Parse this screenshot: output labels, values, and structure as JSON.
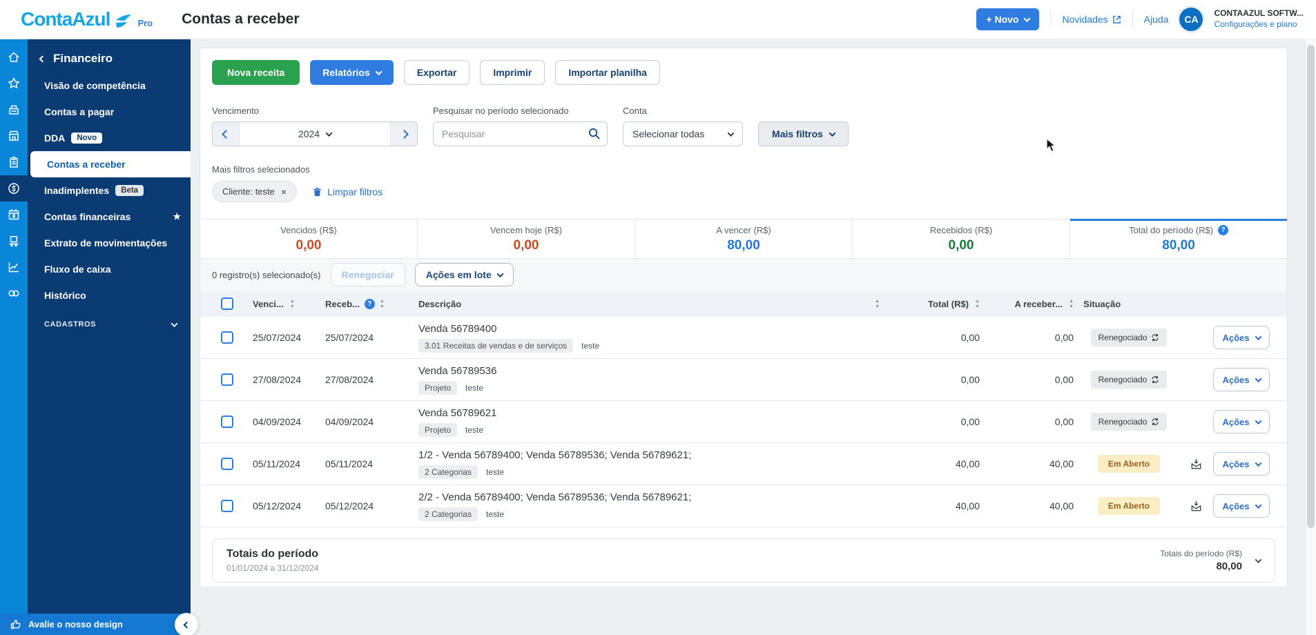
{
  "header": {
    "logo_conta_azul": "ContaAzul",
    "logo_pro": "Pro",
    "page_title": "Contas a receber",
    "novo_button": "+ Novo",
    "novidades_link": "Novidades",
    "ajuda_link": "Ajuda",
    "avatar_initials": "CA",
    "account_name": "CONTAAZUL SOFTW...",
    "account_link": "Configurações e plano"
  },
  "sidebar": {
    "rail_icons": [
      "home",
      "star",
      "cash-register",
      "store",
      "clipboard",
      "dollar-circle",
      "calendar-money",
      "delivery",
      "line-chart",
      "link"
    ],
    "rail_active_index": 5,
    "back_label": "Financeiro",
    "items": [
      {
        "label": "Visão de competência"
      },
      {
        "label": "Contas a pagar"
      },
      {
        "label": "DDA",
        "badge": "Novo",
        "badge_style": "white"
      },
      {
        "label": "Contas a receber",
        "active": true
      },
      {
        "label": "Inadimplentes",
        "badge": "Beta",
        "badge_style": "gray"
      },
      {
        "label": "Contas financeiras",
        "star": true
      },
      {
        "label": "Extrato de movimentações"
      },
      {
        "label": "Fluxo de caixa"
      },
      {
        "label": "Histórico"
      }
    ],
    "cadastros_label": "CADASTROS",
    "rate_design_label": "Avalie o nosso design"
  },
  "actions": {
    "nova_receita": "Nova receita",
    "relatorios": "Relatórios",
    "exportar": "Exportar",
    "imprimir": "Imprimir",
    "importar_planilha": "Importar planilha"
  },
  "filters": {
    "vencimento_label": "Vencimento",
    "year_value": "2024",
    "search_label": "Pesquisar no período selecionado",
    "search_placeholder": "Pesquisar",
    "conta_label": "Conta",
    "conta_value": "Selecionar todas",
    "mais_filtros_button": "Mais filtros",
    "selected_label": "Mais filtros selecionados",
    "chip_label": "Cliente: teste",
    "limpar_filtros": "Limpar filtros"
  },
  "summary_cards": [
    {
      "label": "Vencidos (R$)",
      "value": "0,00",
      "color": "#cb4a23"
    },
    {
      "label": "Vencem hoje (R$)",
      "value": "0,00",
      "color": "#cb4a23"
    },
    {
      "label": "A vencer (R$)",
      "value": "80,00",
      "color": "#2277d4"
    },
    {
      "label": "Recebidos (R$)",
      "value": "0,00",
      "color": "#1e7a3c"
    },
    {
      "label": "Total do período (R$)",
      "value": "80,00",
      "color": "#2277d4",
      "help": true,
      "active": true
    }
  ],
  "list_toolbar": {
    "selection_text": "0 registro(s) selecionado(s)",
    "renegociar_button": "Renegociar",
    "acoes_em_lote_button": "Ações em lote"
  },
  "table": {
    "headers": {
      "vencimento": "Venci...",
      "recebimento": "Receb...",
      "descricao": "Descrição",
      "total": "Total (R$)",
      "a_receber": "A receber...",
      "situacao": "Situação"
    },
    "acoes_label": "Ações",
    "rows": [
      {
        "venc": "25/07/2024",
        "receb": "25/07/2024",
        "title": "Venda 56789400",
        "tag": "3.01 Receitas de vendas e de serviços",
        "note": "teste",
        "total": "0,00",
        "a_receber": "0,00",
        "status": "Renegociado",
        "status_type": "renegociado",
        "envelope": false
      },
      {
        "venc": "27/08/2024",
        "receb": "27/08/2024",
        "title": "Venda 56789536",
        "tag": "Projeto",
        "note": "teste",
        "total": "0,00",
        "a_receber": "0,00",
        "status": "Renegociado",
        "status_type": "renegociado",
        "envelope": false
      },
      {
        "venc": "04/09/2024",
        "receb": "04/09/2024",
        "title": "Venda 56789621",
        "tag": "Projeto",
        "note": "teste",
        "total": "0,00",
        "a_receber": "0,00",
        "status": "Renegociado",
        "status_type": "renegociado",
        "envelope": false
      },
      {
        "venc": "05/11/2024",
        "receb": "05/11/2024",
        "title": "1/2 - Venda 56789400; Venda 56789536; Venda 56789621;",
        "tag": "2 Categorias",
        "note": "teste",
        "total": "40,00",
        "a_receber": "40,00",
        "status": "Em Aberto",
        "status_type": "em-aberto",
        "envelope": true
      },
      {
        "venc": "05/12/2024",
        "receb": "05/12/2024",
        "title": "2/2 - Venda 56789400; Venda 56789536; Venda 56789621;",
        "tag": "2 Categorias",
        "note": "teste",
        "total": "40,00",
        "a_receber": "40,00",
        "status": "Em Aberto",
        "status_type": "em-aberto",
        "envelope": true
      }
    ]
  },
  "totals_footer": {
    "title": "Totais do período",
    "range": "01/01/2024 a 31/12/2024",
    "right_label": "Totais do período (R$)",
    "right_value": "80,00"
  },
  "colors": {
    "brand_light_blue": "#14a5e3",
    "navy": "#0a3b72",
    "rail_blue": "#0a86d9",
    "accent_blue": "#2f7de1",
    "green": "#2aa14c",
    "overdue_red": "#cb4a23",
    "received_green": "#1e7a3c",
    "open_badge_bg": "#fbeec5",
    "open_badge_text": "#9a621d"
  }
}
